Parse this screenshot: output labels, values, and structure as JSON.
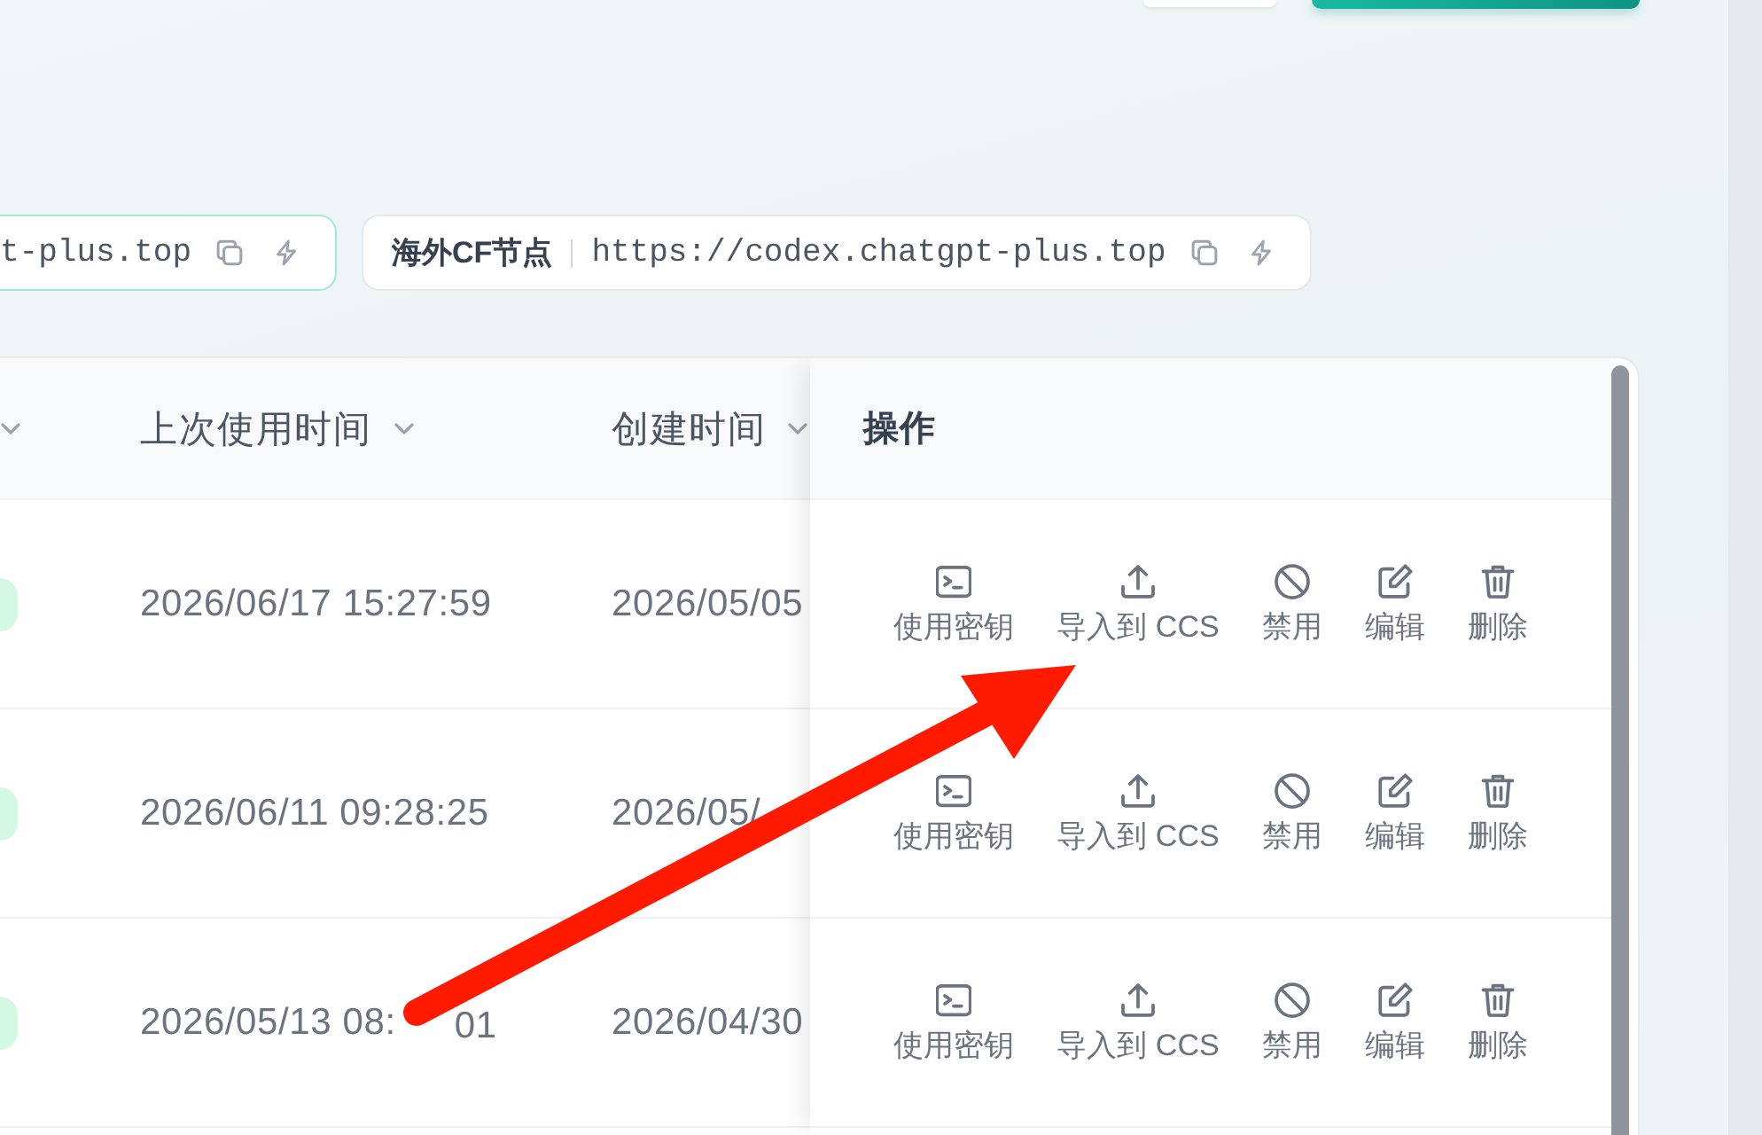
{
  "toolbar": {
    "buttons": [
      {
        "kind": "outline"
      },
      {
        "kind": "primary"
      }
    ]
  },
  "endpoints": [
    {
      "url": "t-plus.top",
      "selected": true
    },
    {
      "label": "海外CF节点",
      "url": "https://codex.chatgpt-plus.top",
      "selected": false
    }
  ],
  "table": {
    "columns": [
      {
        "sortable": true
      },
      {
        "title": "上次使用时间",
        "sortable": true
      },
      {
        "title": "创建时间",
        "sortable": true
      },
      {
        "title": "操作",
        "sortable": false
      }
    ],
    "rows": [
      {
        "last_used": [
          "2026/06/17 15:27:59"
        ],
        "created": "2026/05/05",
        "actions": [
          {
            "kind": "terminal",
            "label": "使用密钥"
          },
          {
            "kind": "upload",
            "label": "导入到 CCS"
          },
          {
            "kind": "disable",
            "label": "禁用"
          },
          {
            "kind": "edit",
            "label": "编辑"
          },
          {
            "kind": "delete",
            "label": "删除"
          }
        ]
      },
      {
        "last_used": [
          "2026/06/11 09:28:25"
        ],
        "created": "2026/05/",
        "actions": [
          {
            "kind": "terminal",
            "label": "使用密钥"
          },
          {
            "kind": "upload",
            "label": "导入到 CCS"
          },
          {
            "kind": "disable",
            "label": "禁用"
          },
          {
            "kind": "edit",
            "label": "编辑"
          },
          {
            "kind": "delete",
            "label": "删除"
          }
        ]
      },
      {
        "last_used": [
          "2026/05/13 08:",
          "01"
        ],
        "created": "2026/04/30",
        "actions": [
          {
            "kind": "terminal",
            "label": "使用密钥"
          },
          {
            "kind": "upload",
            "label": "导入到 CCS"
          },
          {
            "kind": "disable",
            "label": "禁用"
          },
          {
            "kind": "edit",
            "label": "编辑"
          },
          {
            "kind": "delete",
            "label": "删除"
          }
        ]
      }
    ]
  },
  "annotation": {
    "kind": "arrow"
  }
}
